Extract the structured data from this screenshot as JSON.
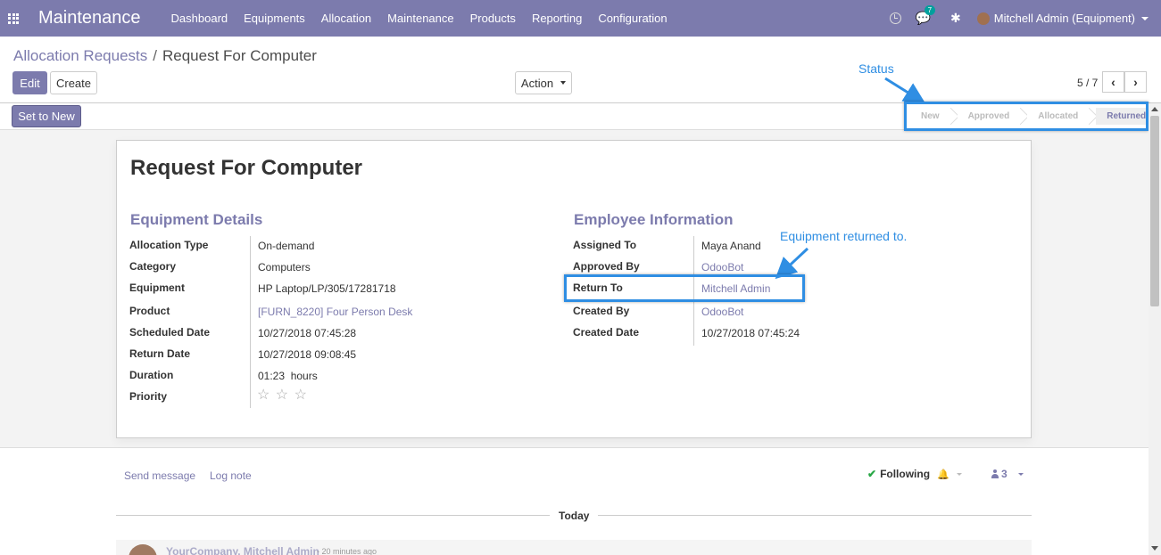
{
  "navbar": {
    "app_name": "Maintenance",
    "menu": [
      "Dashboard",
      "Equipments",
      "Allocation",
      "Maintenance",
      "Products",
      "Reporting",
      "Configuration"
    ],
    "messages_count": "7",
    "user_name": "Mitchell Admin (Equipment)",
    "brand_color": "#7c7bad"
  },
  "breadcrumb": {
    "parent": "Allocation Requests",
    "separator": "/",
    "current": "Request For Computer"
  },
  "buttons": {
    "edit": "Edit",
    "create": "Create",
    "action": "Action",
    "set_to_new": "Set to New"
  },
  "pager": {
    "text": "5 / 7"
  },
  "statusbar": {
    "stages": [
      "New",
      "Approved",
      "Allocated",
      "Returned"
    ],
    "active": "Returned"
  },
  "annotations": {
    "status": "Status",
    "returned_to": "Equipment returned to.",
    "color": "#2f8ee3"
  },
  "record": {
    "title": "Request For Computer",
    "equipment_details": {
      "heading": "Equipment Details",
      "fields": [
        {
          "label": "Allocation Type",
          "value": "On-demand"
        },
        {
          "label": "Category",
          "value": "Computers"
        },
        {
          "label": "Equipment",
          "value": "HP Laptop/LP/305/17281718"
        },
        {
          "label": "Product",
          "value": "[FURN_8220] Four Person Desk"
        },
        {
          "label": "Scheduled Date",
          "value": "10/27/2018 07:45:28"
        },
        {
          "label": "Return Date",
          "value": "10/27/2018 09:08:45"
        },
        {
          "label": "Duration",
          "value": "01:23  hours"
        },
        {
          "label": "Priority",
          "value": "☆ ☆ ☆"
        }
      ]
    },
    "employee_information": {
      "heading": "Employee Information",
      "fields": [
        {
          "label": "Assigned To",
          "value": "Maya Anand"
        },
        {
          "label": "Approved By",
          "value": "OdooBot"
        },
        {
          "label": "Return To",
          "value": "Mitchell Admin"
        },
        {
          "label": "Created By",
          "value": "OdooBot"
        },
        {
          "label": "Created Date",
          "value": "10/27/2018 07:45:24"
        }
      ]
    }
  },
  "chatter": {
    "send_message": "Send message",
    "log_note": "Log note",
    "following": "Following",
    "followers_count": "3",
    "day_separator": "Today",
    "message": {
      "author": "YourCompany, Mitchell Admin",
      "time": "- 20 minutes ago"
    }
  }
}
